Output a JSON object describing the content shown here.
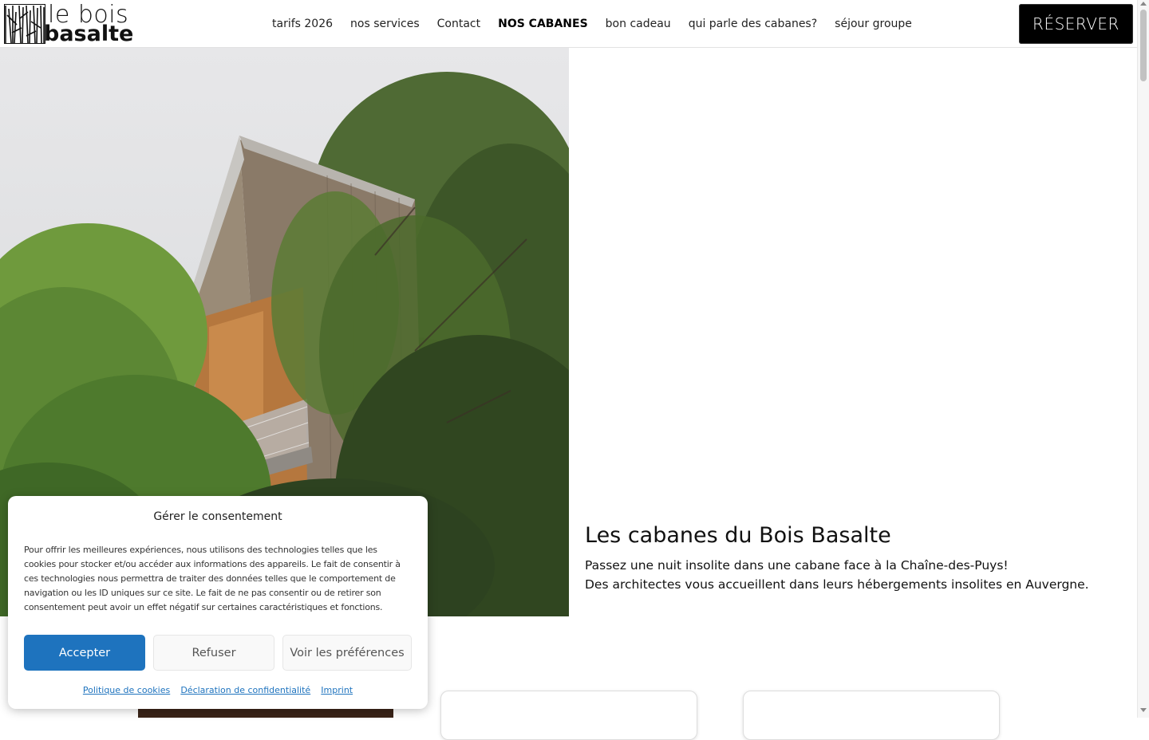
{
  "header": {
    "logo_line1": "le bois",
    "logo_line2": "basalte",
    "nav": [
      {
        "label": "tarifs 2026"
      },
      {
        "label": "nos services"
      },
      {
        "label": "Contact"
      },
      {
        "label": "NOS CABANES",
        "active": true
      },
      {
        "label": "bon cadeau"
      },
      {
        "label": "qui parle des cabanes?"
      },
      {
        "label": "séjour groupe"
      }
    ],
    "reserve_label": "RÉSERVER"
  },
  "hero": {
    "title": "Les cabanes du Bois Basalte",
    "line1": "Passez une nuit insolite dans une cabane face à la Chaîne-des-Puys!",
    "line2": "Des architectes vous accueillent dans leurs hébergements insolites en Auvergne."
  },
  "consent": {
    "title": "Gérer le consentement",
    "text": "Pour offrir les meilleures expériences, nous utilisons des technologies telles que les cookies pour stocker et/ou accéder aux informations des appareils. Le fait de consentir à ces technologies nous permettra de traiter des données telles que le comportement de navigation ou les ID uniques sur ce site. Le fait de ne pas consentir ou de retirer son consentement peut avoir un effet négatif sur certaines caractéristiques et fonctions.",
    "accept": "Accepter",
    "refuse": "Refuser",
    "preferences": "Voir les préférences",
    "links": [
      "Politique de cookies",
      "Déclaration de confidentialité",
      "Imprint"
    ]
  },
  "colors": {
    "accent": "#1e73be",
    "button_dark": "#000000"
  }
}
